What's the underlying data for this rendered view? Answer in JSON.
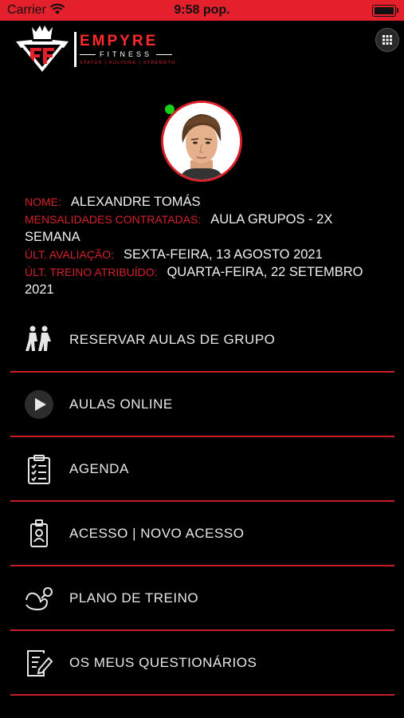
{
  "status_bar": {
    "carrier": "Carrier",
    "time": "9:58 pop.",
    "battery_level": 1.0
  },
  "brand": {
    "name": "EMPYRE",
    "sub": "FITNESS",
    "tagline": "STATUS | KULTURE | STRENGTH",
    "accent_color": "#e3202b"
  },
  "profile": {
    "name_label": "NOME:",
    "name_value": "ALEXANDRE TOMÁS",
    "plan_label": "MENSALIDADES CONTRATADAS:",
    "plan_value": "AULA GRUPOS - 2X SEMANA",
    "eval_label": "ÚLT. AVALIAÇÃO:",
    "eval_value": "SEXTA-FEIRA, 13 AGOSTO 2021",
    "train_label": "ÚLT. TREINO ATRIBUÍDO:",
    "train_value": "QUARTA-FEIRA, 22 SETEMBRO 2021",
    "status": "online"
  },
  "menu": [
    {
      "label": "RESERVAR AULAS DE GRUPO",
      "icon": "group-runners-icon"
    },
    {
      "label": "AULAS ONLINE",
      "icon": "play-icon"
    },
    {
      "label": "AGENDA",
      "icon": "clipboard-checklist-icon"
    },
    {
      "label": "ACESSO | NOVO ACESSO",
      "icon": "id-badge-icon"
    },
    {
      "label": "PLANO DE TREINO",
      "icon": "arm-dumbbell-icon"
    },
    {
      "label": "OS MEUS QUESTIONÁRIOS",
      "icon": "form-pencil-icon"
    }
  ]
}
